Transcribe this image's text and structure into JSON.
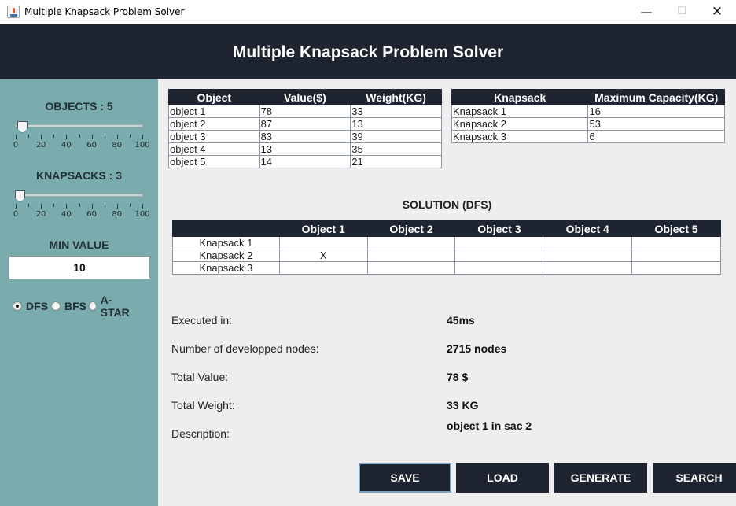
{
  "window": {
    "title": "Multiple Knapsack Problem Solver",
    "controls": {
      "minimize": "—",
      "maximize": "☐",
      "close": "✕"
    }
  },
  "header": {
    "title": "Multiple Knapsack Problem Solver"
  },
  "sidebar": {
    "objects_label": "OBJECTS : 5",
    "objects_value": 5,
    "knapsacks_label": "KNAPSACKS : 3",
    "knapsacks_value": 3,
    "slider_range": [
      0,
      100
    ],
    "slider_tick_labels": [
      "0",
      "20",
      "40",
      "60",
      "80",
      "100"
    ],
    "min_value_label": "MIN VALUE",
    "min_value": "10",
    "algorithms": [
      {
        "label": "DFS",
        "selected": true
      },
      {
        "label": "BFS",
        "selected": false
      },
      {
        "label": "A-STAR",
        "selected": false
      }
    ]
  },
  "objects_table": {
    "headers": [
      "Object",
      "Value($)",
      "Weight(KG)"
    ],
    "rows": [
      [
        "object 1",
        "78",
        "33"
      ],
      [
        "object 2",
        "87",
        "13"
      ],
      [
        "object 3",
        "83",
        "39"
      ],
      [
        "object 4",
        "13",
        "35"
      ],
      [
        "object 5",
        "14",
        "21"
      ]
    ]
  },
  "knapsacks_table": {
    "headers": [
      "Knapsack",
      "Maximum Capacity(KG)"
    ],
    "rows": [
      [
        "Knapsack 1",
        "16"
      ],
      [
        "Knapsack 2",
        "53"
      ],
      [
        "Knapsack 3",
        "6"
      ]
    ]
  },
  "solution": {
    "title": "SOLUTION (DFS)",
    "headers": [
      "",
      "Object 1",
      "Object 2",
      "Object 3",
      "Object 4",
      "Object 5"
    ],
    "rows": [
      [
        "Knapsack 1",
        "",
        "",
        "",
        "",
        ""
      ],
      [
        "Knapsack 2",
        "X",
        "",
        "",
        "",
        ""
      ],
      [
        "Knapsack 3",
        "",
        "",
        "",
        "",
        ""
      ]
    ]
  },
  "stats": [
    {
      "label": "Executed in:",
      "value": "45ms"
    },
    {
      "label": "Number of developped nodes:",
      "value": "2715 nodes"
    },
    {
      "label": "Total Value:",
      "value": "78 $"
    },
    {
      "label": "Total Weight:",
      "value": "33 KG"
    },
    {
      "label": "Description:",
      "value": "object 1 in sac 2"
    }
  ],
  "buttons": {
    "save": "SAVE",
    "load": "LOAD",
    "generate": "GENERATE",
    "search": "SEARCH"
  },
  "colors": {
    "header_bg": "#1e2530",
    "sidebar_bg": "#7aabad",
    "main_bg": "#eeeeee",
    "button_bg": "#1e2530"
  }
}
